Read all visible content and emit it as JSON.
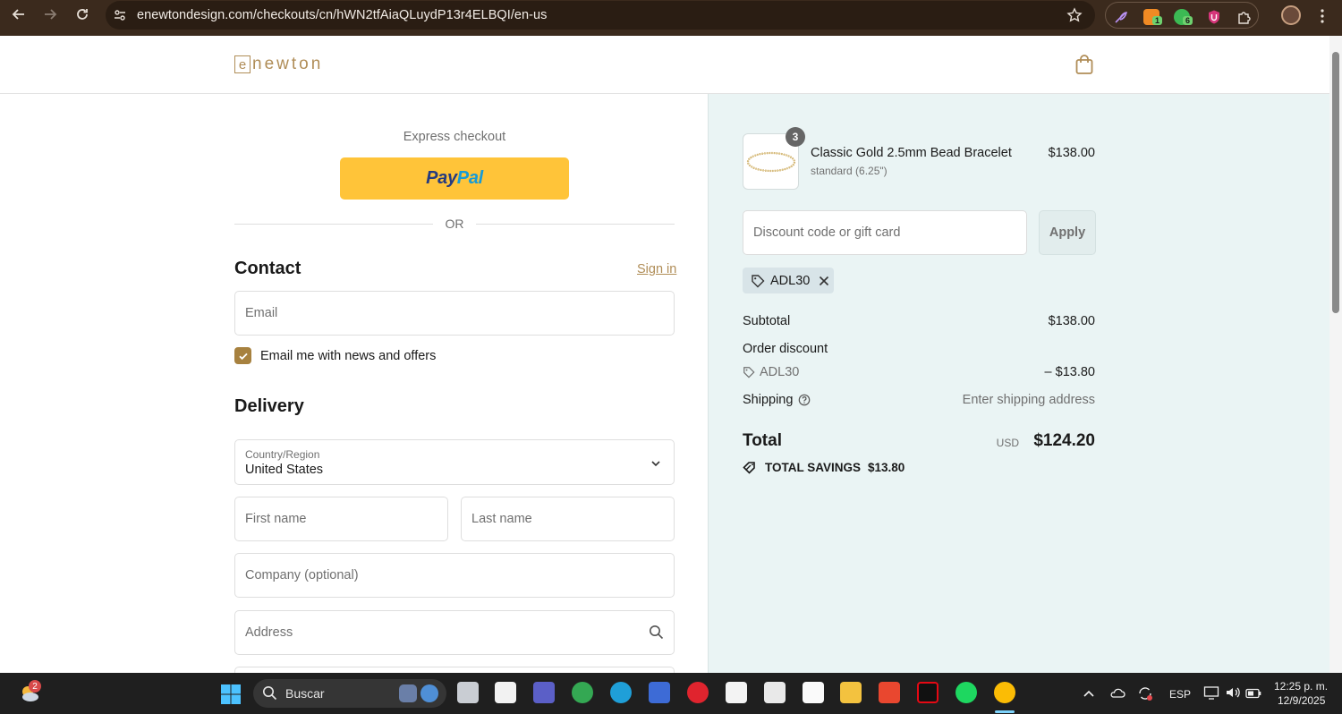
{
  "browser": {
    "url": "enewtondesign.com/checkouts/cn/hWN2tfAiaQLuydP13r4ELBQI/en-us",
    "extension_badges": [
      "1",
      "6"
    ]
  },
  "site": {
    "logo_mark": "e",
    "logo_text": "newton"
  },
  "checkout": {
    "express_label": "Express checkout",
    "paypal_pay": "Pay",
    "paypal_pal": "Pal",
    "or_label": "OR",
    "contact": {
      "title": "Contact",
      "sign_in": "Sign in",
      "email_placeholder": "Email",
      "newsletter_label": "Email me with news and offers",
      "newsletter_checked": true
    },
    "delivery": {
      "title": "Delivery",
      "country_label": "Country/Region",
      "country_value": "United States",
      "first_name_placeholder": "First name",
      "last_name_placeholder": "Last name",
      "company_placeholder": "Company (optional)",
      "address_placeholder": "Address"
    }
  },
  "summary": {
    "item": {
      "quantity": "3",
      "name": "Classic Gold 2.5mm Bead Bracelet",
      "variant": "standard (6.25\")",
      "price": "$138.00"
    },
    "discount_placeholder": "Discount code or gift card",
    "apply_label": "Apply",
    "applied_code": "ADL30",
    "subtotal_label": "Subtotal",
    "subtotal_value": "$138.00",
    "order_discount_label": "Order discount",
    "discount_code": "ADL30",
    "discount_value": "– $13.80",
    "shipping_label": "Shipping",
    "shipping_value": "Enter shipping address",
    "total_label": "Total",
    "total_currency": "USD",
    "total_value": "$124.20",
    "savings_label": "TOTAL SAVINGS",
    "savings_value": "$13.80"
  },
  "taskbar": {
    "weather_badge": "2",
    "search_label": "Buscar",
    "language": "ESP",
    "time": "12:25 p. m.",
    "date": "12/9/2025"
  },
  "colors": {
    "accent": "#b08d57",
    "checkbox": "#a7813f",
    "paypal_yellow": "#ffc439",
    "summary_bg": "#eaf4f4",
    "chrome_bg": "#3b2a1d"
  }
}
